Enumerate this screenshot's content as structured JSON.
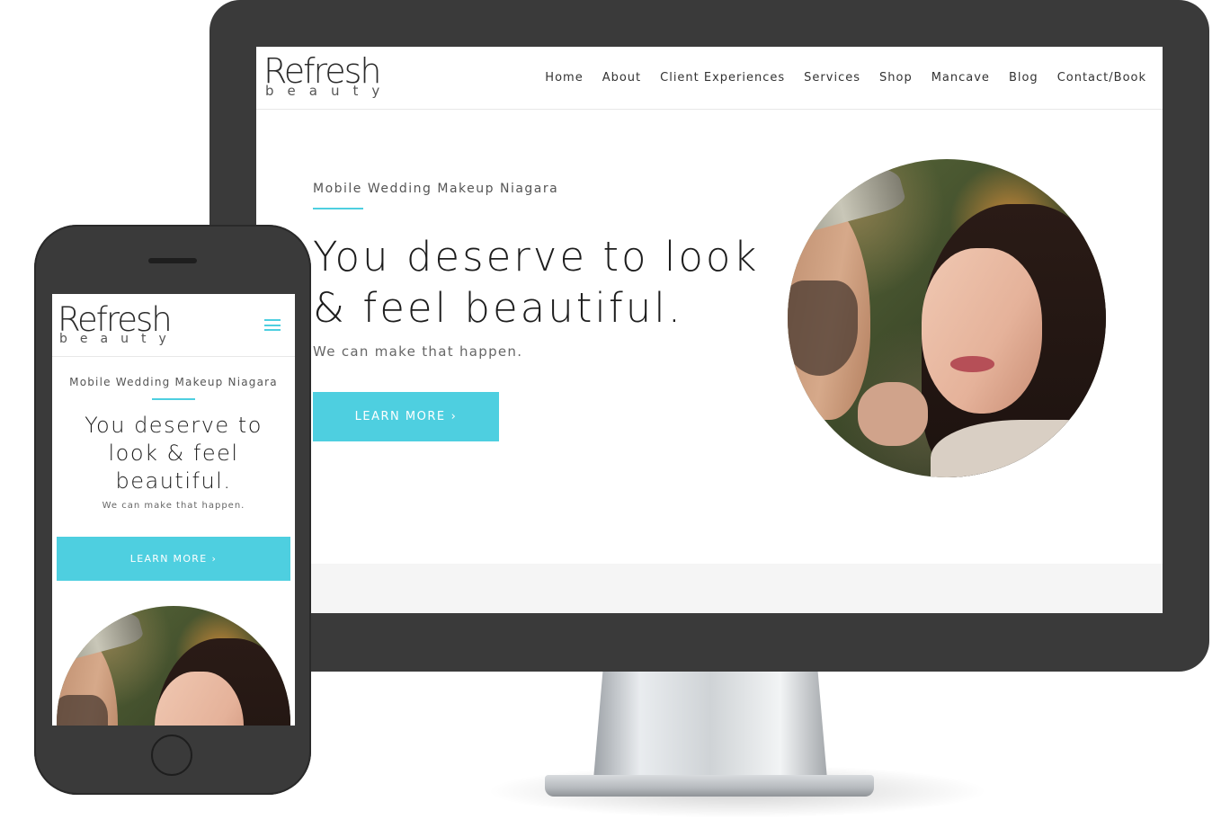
{
  "desktop": {
    "logo": {
      "word": "Refresh",
      "sub": "beauty"
    },
    "nav": [
      "Home",
      "About",
      "Client Experiences",
      "Services",
      "Shop",
      "Mancave",
      "Blog",
      "Contact/Book"
    ],
    "hero": {
      "kicker": "Mobile Wedding Makeup Niagara",
      "headline": "You deserve to look & feel beautiful.",
      "subline": "We can make that happen.",
      "button_label": "LEARN MORE",
      "button_icon": "chevron-right-icon"
    }
  },
  "mobile": {
    "logo": {
      "word": "Refresh",
      "sub": "beauty"
    },
    "menu_icon": "hamburger-menu-icon",
    "hero": {
      "kicker": "Mobile Wedding Makeup Niagara",
      "headline": "You deserve to look & feel beautiful.",
      "subline": "We can make that happen.",
      "button_label": "LEARN MORE",
      "button_icon": "chevron-right-icon"
    }
  },
  "colors": {
    "accent": "#4ecfe0",
    "device_body": "#3a3a3a",
    "text_dark": "#1d1d1d"
  }
}
